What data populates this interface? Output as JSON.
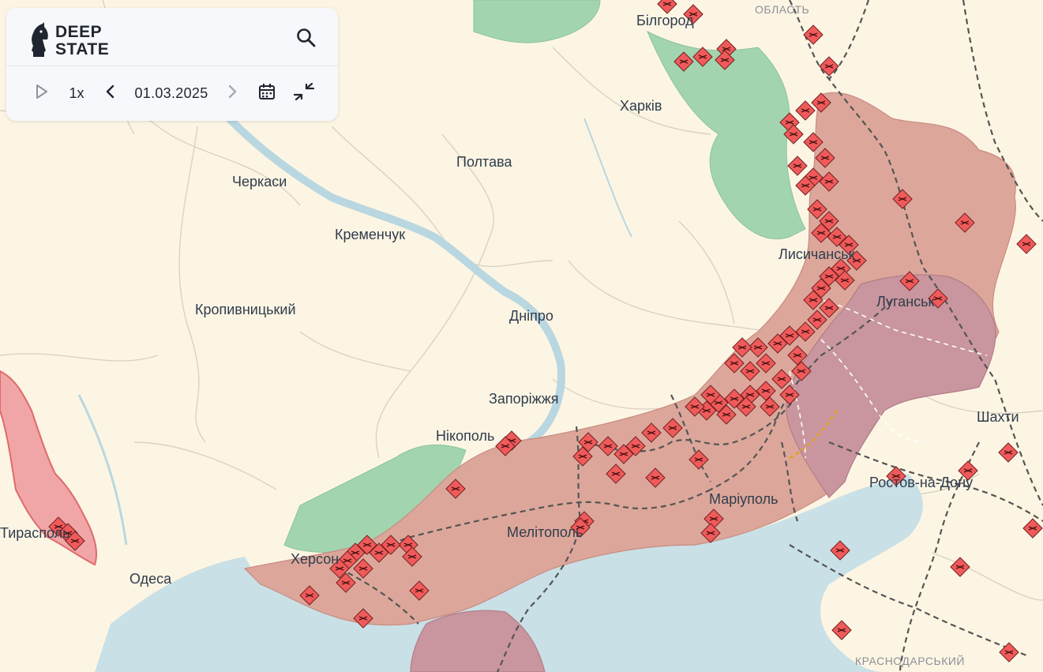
{
  "app": {
    "logo_line1": "DEEP",
    "logo_line2": "STATE"
  },
  "controls": {
    "speed": "1x",
    "date": "01.03.2025"
  },
  "icons": {
    "logo": "knight-chess-icon",
    "search": "search-icon",
    "play": "play-icon",
    "prev": "chevron-left-icon",
    "next": "chevron-right-icon",
    "calendar": "calendar-icon",
    "collapse": "collapse-arrows-icon"
  },
  "map": {
    "regions": [
      "ОБЛАСТЬ",
      "КРАСНОДАРСЬКИЙ"
    ],
    "cities": [
      "Бiлгород",
      "Харкiв",
      "Полтава",
      "Черкаси",
      "Кременчук",
      "Лисичанськ",
      "Луганськ",
      "Кропивницький",
      "Днiпро",
      "Запорiжжя",
      "Шахти",
      "Нiкополь",
      "Ростов-на-Дону",
      "Марiуполь",
      "Мелiтополь",
      "Тирасполь",
      "Херсон",
      "Одеса"
    ]
  },
  "colors": {
    "land": "#fdf5e4",
    "sea": "#c9e0e6",
    "occupied": "#dca79a",
    "occupied_pre2022": "#c9969f",
    "liberated": "#a3d4b0",
    "transnistria": "#f0a6a6",
    "marker": "#f05a5a"
  }
}
